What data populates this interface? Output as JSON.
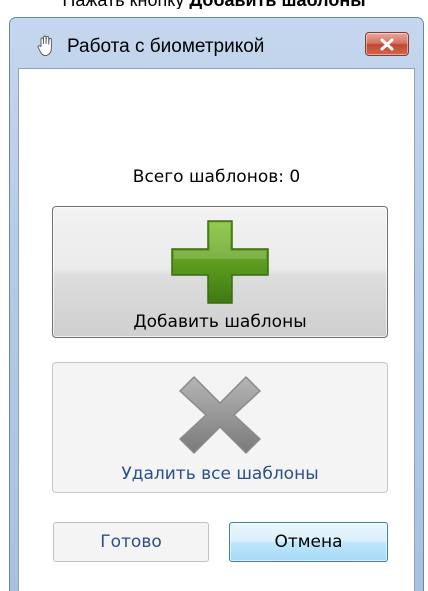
{
  "instruction": {
    "prefix": "Нажать кнопку ",
    "emphasis": "Добавить шаблоны"
  },
  "window": {
    "title": "Работа с биометрикой",
    "title_icon": "hand-icon",
    "close_icon": "close-icon"
  },
  "content": {
    "total_label": "Всего шаблонов: 0",
    "add_button": {
      "label": "Добавить шаблоны",
      "icon": "plus-icon",
      "icon_color": "#5a9a1e"
    },
    "remove_button": {
      "label": "Удалить все шаблоны",
      "icon": "cross-icon",
      "icon_color": "#8e8e8e"
    }
  },
  "footer": {
    "done_label": "Готово",
    "cancel_label": "Отмена"
  },
  "colors": {
    "accent_blue": "#2b4f86",
    "close_red": "#c2472f"
  }
}
